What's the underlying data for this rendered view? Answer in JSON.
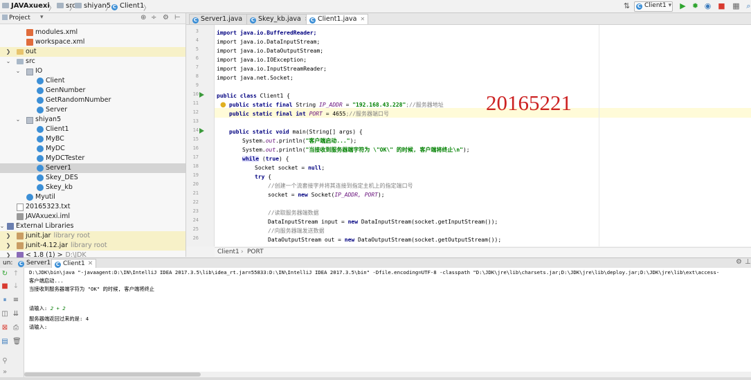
{
  "navbar": {
    "project": "JAVAxuexi",
    "src": "src",
    "pkg": "shiyan5",
    "cls": "Client1",
    "run_config": "Client1"
  },
  "project_panel": {
    "title": "Project",
    "tree": [
      {
        "label": "modules.xml",
        "icon": "xml-icon"
      },
      {
        "label": "workspace.xml",
        "icon": "xml-icon"
      },
      {
        "label": "out",
        "icon": "folder-icon"
      },
      {
        "label": "src",
        "icon": "folder-icon"
      },
      {
        "label": "IO",
        "icon": "package-icon"
      },
      {
        "label": "Client",
        "icon": "class-icon"
      },
      {
        "label": "GenNumber",
        "icon": "class-icon"
      },
      {
        "label": "GetRandomNumber",
        "icon": "class-icon"
      },
      {
        "label": "Server",
        "icon": "class-icon"
      },
      {
        "label": "shiyan5",
        "icon": "package-icon"
      },
      {
        "label": "Client1",
        "icon": "class-icon"
      },
      {
        "label": "MyBC",
        "icon": "class-icon"
      },
      {
        "label": "MyDC",
        "icon": "class-icon"
      },
      {
        "label": "MyDCTester",
        "icon": "class-icon"
      },
      {
        "label": "Server1",
        "icon": "class-icon"
      },
      {
        "label": "Skey_DES",
        "icon": "class-icon"
      },
      {
        "label": "Skey_kb",
        "icon": "class-icon"
      },
      {
        "label": "Myutil",
        "icon": "class-icon"
      },
      {
        "label": "20165323.txt",
        "icon": "text-file-icon"
      },
      {
        "label": "JAVAxuexi.iml",
        "icon": "iml-file-icon"
      },
      {
        "label": "External Libraries",
        "icon": "libraries-icon"
      },
      {
        "label": "junit.jar",
        "suffix": "library root",
        "icon": "jar-icon"
      },
      {
        "label": "junit-4.12.jar",
        "suffix": "library root",
        "icon": "jar-icon"
      },
      {
        "label": "< 1.8 (1) >",
        "suffix": "D:\\JDK",
        "icon": "jdk-icon"
      }
    ]
  },
  "editor": {
    "tabs": [
      "Server1.java",
      "Skey_kb.java",
      "Client1.java"
    ],
    "line_numbers": [
      "3",
      "4",
      "5",
      "6",
      "7",
      "8",
      "9",
      "10",
      "11",
      "12",
      "13",
      "14",
      "15",
      "16",
      "17",
      "18",
      "19",
      "20",
      "21",
      "22",
      "23",
      "24",
      "25",
      "26"
    ],
    "lines": {
      "l3": "import java.io.BufferedReader;",
      "l4": "import java.io.DataInputStream;",
      "l5": "import java.io.DataOutputStream;",
      "l6": "import java.io.IOException;",
      "l7": "import java.io.InputStreamReader;",
      "l8": "import java.net.Socket;",
      "l10_kw": "public class",
      "l10_rest": " Client1 {",
      "l11_kw": "public static final",
      "l11_type": " String ",
      "l11_name": "IP_ADDR",
      "l11_eq": " = ",
      "l11_str": "\"192.168.43.228\"",
      "l11_cm": ";//服务器地址",
      "l12_kw": "public static final int",
      "l12_name": " PORT",
      "l12_eq": " = 4655",
      "l12_cm": ";//服务器端口号",
      "l14_kw": "public static void",
      "l14_rest": " main(String[] args) {",
      "l15_a": "System.",
      "l15_b": "out",
      "l15_c": ".println(",
      "l15_str": "\"客户端启动...\"",
      "l15_d": ");",
      "l16_a": "System.",
      "l16_b": "out",
      "l16_c": ".println(",
      "l16_str": "\"当接收到服务器端字符为 \\\"OK\\\" 的时候, 客户端将终止\\n\"",
      "l16_d": ");",
      "l17_kw": "while",
      "l17_a": " (",
      "l17_kw2": "true",
      "l17_b": ") {",
      "l18_a": "Socket socket = ",
      "l18_kw": "null",
      "l18_b": ";",
      "l19_kw": "try",
      "l19_b": " {",
      "l20_cm": "//创建一个流套接字并将其连接到指定主机上的指定端口号",
      "l21_a": "socket = ",
      "l21_kw": "new",
      "l21_b": " Socket(",
      "l21_it": "IP_ADDR, PORT",
      "l21_c": ");",
      "l23_cm": "//读取服务器端数据",
      "l24_a": "DataInputStream input = ",
      "l24_kw": "new",
      "l24_b": " DataInputStream(socket.getInputStream());",
      "l25_cm": "//向服务器端发送数据",
      "l26_a": "DataOutputStream out = ",
      "l26_kw": "new",
      "l26_b": " DataOutputStream(socket.getOutputStream());"
    },
    "breadcrumb_class": "Client1",
    "breadcrumb_field": "PORT"
  },
  "watermark": "20165221",
  "run_panel": {
    "label": "un:",
    "tabs": [
      "Server1",
      "Client1"
    ],
    "console": [
      "D:\\JDK\\bin\\java \"-javaagent:D:\\IN\\IntelliJ IDEA 2017.3.5\\lib\\idea_rt.jar=55833:D:\\IN\\IntelliJ IDEA 2017.3.5\\bin\" -Dfile.encoding=UTF-8 -classpath \"D:\\JDK\\jre\\lib\\charsets.jar;D:\\JDK\\jre\\lib\\deploy.jar;D:\\JDK\\jre\\lib\\ext\\access-",
      "客户端启动...",
      "当接收到服务器端字符为 \"OK\" 的时候, 客户端将终止",
      "",
      "请输入: ",
      "服务器端返回过来的是: 4",
      "请输入:"
    ],
    "console_input": "2 + 2"
  },
  "colors": {
    "keyword": "#000080",
    "string": "#008000",
    "comment": "#808080",
    "watermark": "#cc2222"
  }
}
